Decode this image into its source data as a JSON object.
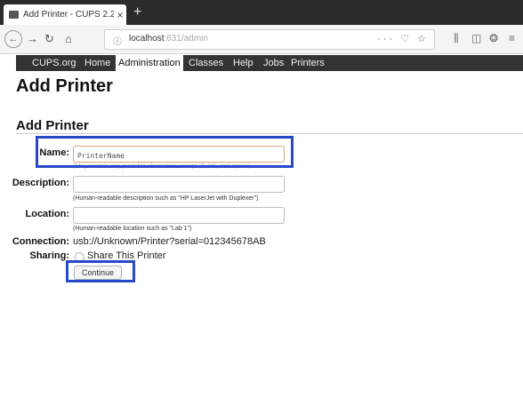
{
  "browser": {
    "tab_title": "Add Printer - CUPS 2.2.7",
    "new_tab_symbol": "+",
    "url_host": "localhost",
    "url_rest": ":631/admin",
    "url_actions": "··· ♡ ☆"
  },
  "cups_nav": {
    "items": [
      "CUPS.org",
      "Home",
      "Administration",
      "Classes",
      "Help",
      "Jobs",
      "Printers"
    ],
    "active": "Administration"
  },
  "page": {
    "title": "Add Printer",
    "section_title": "Add Printer"
  },
  "form": {
    "name_label": "Name:",
    "name_value": "PrinterName",
    "name_hint": "(May contain any printable characters except \"/\", \"#\", and space)",
    "description_label": "Description:",
    "description_value": "",
    "description_hint": "(Human-readable description such as \"HP LaserJet with Duplexer\")",
    "location_label": "Location:",
    "location_value": "",
    "location_hint": "(Human-readable location such as \"Lab 1\")",
    "connection_label": "Connection:",
    "connection_value": "usb://Unknown/Printer?serial=012345678AB",
    "sharing_label": "Sharing:",
    "sharing_option": "Share This Printer",
    "sharing_checked": false,
    "continue_label": "Continue"
  },
  "colors": {
    "highlight_box": "#2748c8",
    "menu_bar": "#333333",
    "tab_bar": "#2b2b2b"
  }
}
